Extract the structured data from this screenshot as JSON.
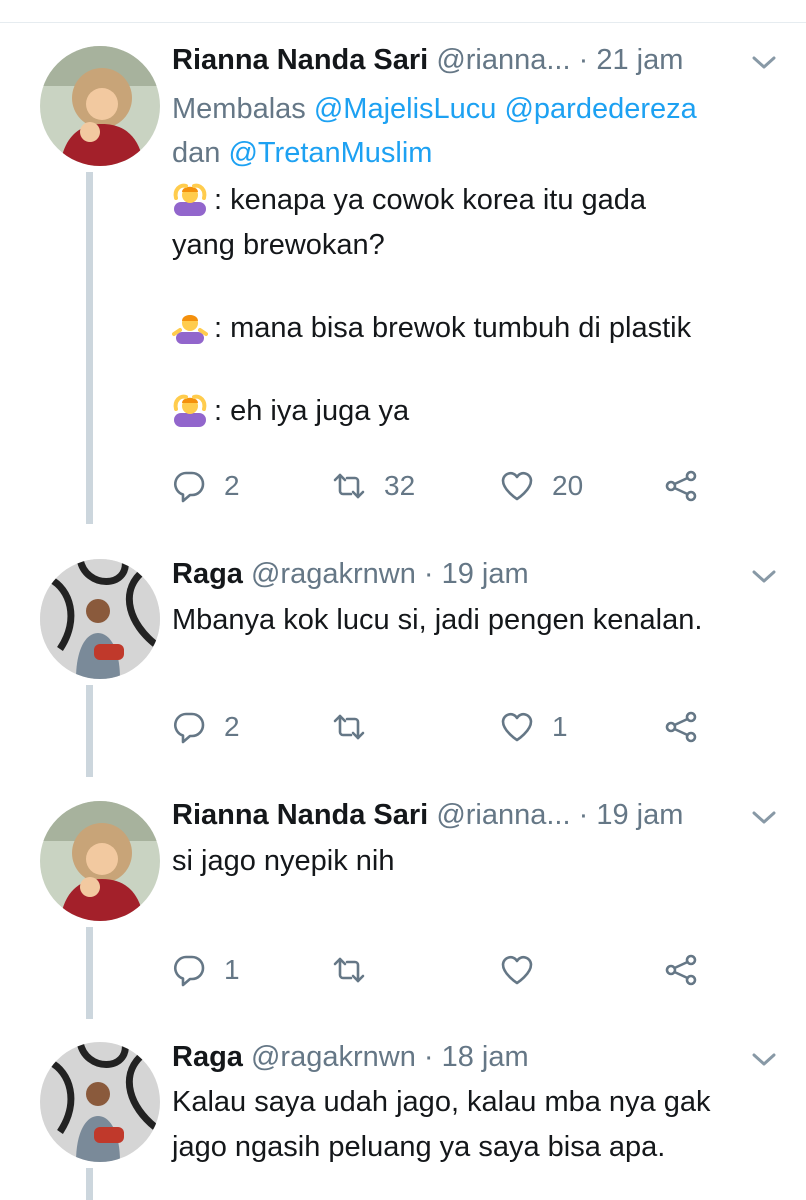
{
  "tweets": [
    {
      "name": "Rianna Nanda Sari",
      "handle": "@rianna...",
      "time": "· 21 jam",
      "reply_to": {
        "prefix": "Membalas",
        "m1": "@MajelisLucu",
        "m2": "@pardedereza",
        "and": "dan",
        "m3": "@TretanMuslim"
      },
      "lines": [
        {
          "emoji": "person-gesturing-ok-emoji",
          "text": ": kenapa ya cowok korea itu gada"
        },
        {
          "text": "yang brewokan?"
        },
        {
          "emoji": "person-shrugging-emoji",
          "text": ": mana bisa brewok tumbuh di plastik"
        },
        {
          "emoji": "person-gesturing-ok-emoji",
          "text": ": eh iya juga ya"
        }
      ],
      "replies": "2",
      "retweets": "32",
      "likes": "20"
    },
    {
      "name": "Raga",
      "handle": "@ragakrnwn",
      "time": "· 19 jam",
      "text": "Mbanya kok lucu si, jadi pengen kenalan.",
      "replies": "2",
      "retweets": "",
      "likes": "1"
    },
    {
      "name": "Rianna Nanda Sari",
      "handle": "@rianna...",
      "time": "· 19 jam",
      "text": "si jago nyepik nih",
      "replies": "1",
      "retweets": "",
      "likes": ""
    },
    {
      "name": "Raga",
      "handle": "@ragakrnwn",
      "time": "· 18 jam",
      "lines": [
        "Kalau saya udah jago, kalau mba nya gak",
        "jago ngasih peluang ya saya bisa apa."
      ]
    }
  ],
  "colors": {
    "text": "#14171a",
    "muted": "#657786",
    "link": "#1da1f2",
    "thread_line": "#ccd6dd",
    "emoji_face": "#ffcc4d",
    "emoji_shirt": "#9266cc"
  },
  "icons": [
    "reply-icon",
    "retweet-icon",
    "like-icon",
    "share-icon",
    "chevron-down-icon"
  ]
}
